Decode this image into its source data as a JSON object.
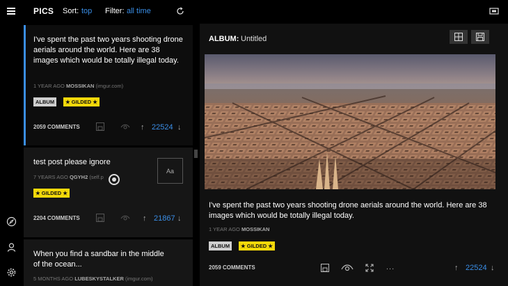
{
  "app": {
    "title": "PICS",
    "sort_label": "Sort:",
    "sort_value": "top",
    "filter_label": "Filter:",
    "filter_value": "all time"
  },
  "icons": {
    "menu": "hamburger-icon",
    "refresh": "refresh-icon",
    "fullscreen": "fullscreen-icon",
    "explore": "compass-icon",
    "profile": "user-icon",
    "settings": "gear-icon",
    "save": "save-icon",
    "hide": "eye-icon",
    "grid": "grid-icon",
    "expand": "expand-icon"
  },
  "colors": {
    "accent": "#3a8ee6",
    "gilded": "#f5d90a",
    "album_badge": "#cfcfcf"
  },
  "posts": [
    {
      "title": "I've spent the past two years shooting drone aerials around the world. Here are 38 images which would be totally illegal today.",
      "age": "1 YEAR AGO",
      "author": "MOSSIKAN",
      "domain": "(imgur.com)",
      "badge_album": "ALBUM",
      "badge_gilded": "★ GILDED ★",
      "comments": "2059 COMMENTS",
      "score": "22524"
    },
    {
      "title": "test post please ignore",
      "age": "7 YEARS AGO",
      "author": "QGYH2",
      "domain": "(self.p",
      "thumb": "Aa",
      "badge_gilded": "★ GILDED ★",
      "comments": "2204 COMMENTS",
      "score": "21867"
    },
    {
      "title": "When you find a sandbar in the middle of the ocean...",
      "age": "5 MONTHS AGO",
      "author": "LUBESKYSTALKER",
      "domain": "(imgur.com)"
    }
  ],
  "detail": {
    "album_label": "ALBUM:",
    "album_name": "Untitled",
    "title": "I've spent the past two years shooting drone aerials around the world. Here are 38 images which would be totally illegal today.",
    "age": "1 YEAR AGO",
    "author": "MOSSIKAN",
    "badge_album": "ALBUM",
    "badge_gilded": "★ GILDED ★",
    "comments": "2059 COMMENTS",
    "more": "...",
    "score": "22524"
  }
}
